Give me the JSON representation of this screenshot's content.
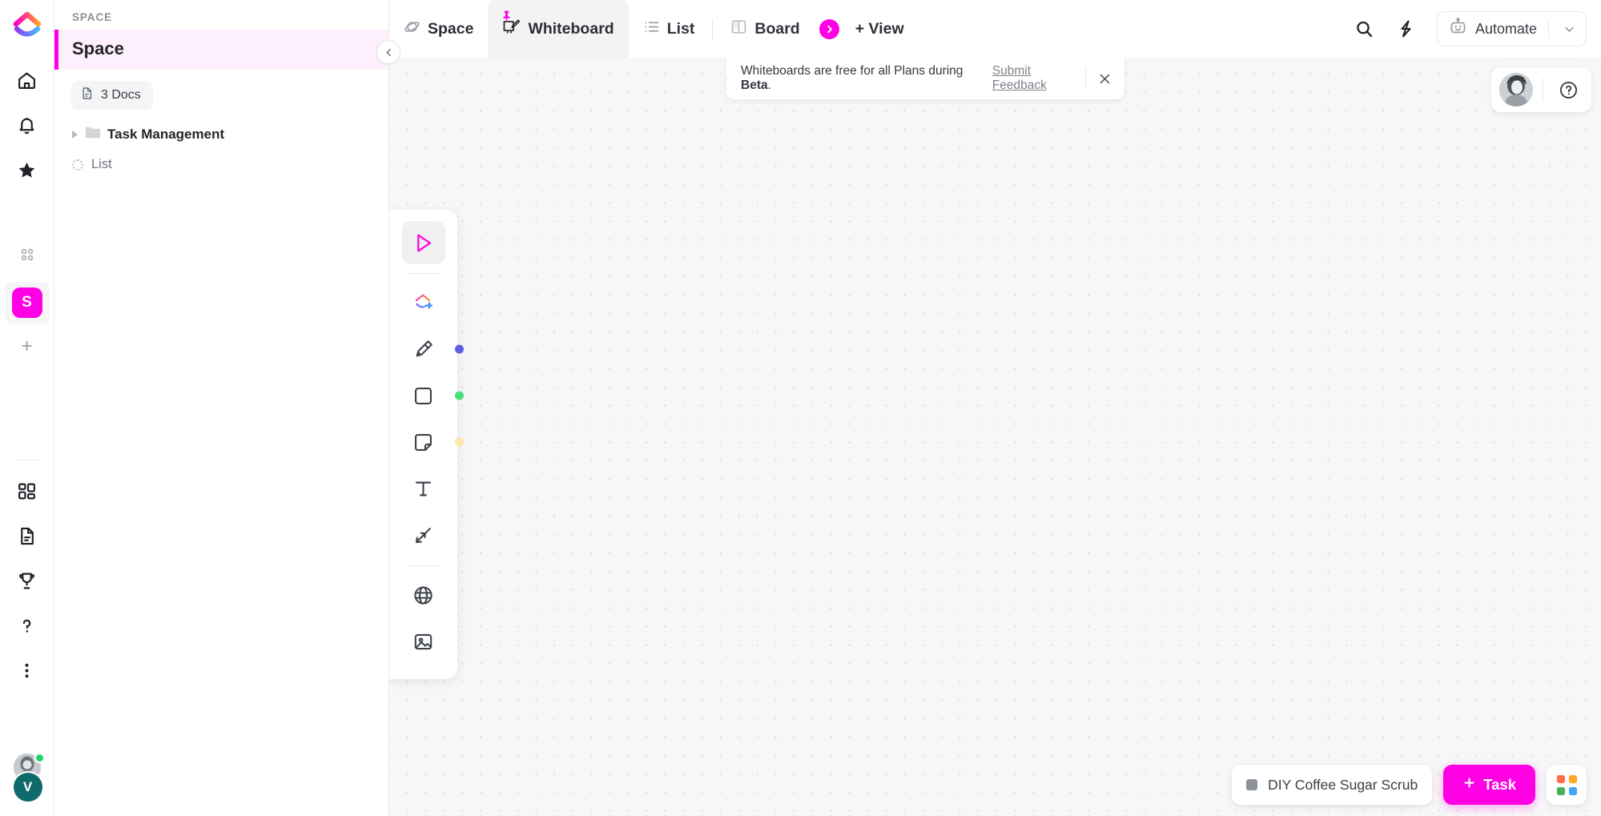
{
  "rail": {
    "logo_icon": "clickup-logo-icon",
    "items": [
      {
        "name": "home",
        "icon": "home-icon"
      },
      {
        "name": "notifications",
        "icon": "bell-icon"
      },
      {
        "name": "favorites",
        "icon": "star-icon"
      },
      {
        "name": "apps",
        "icon": "four-dot-grid-icon"
      }
    ],
    "space_badge": "S",
    "add_label": "+",
    "lower_items": [
      {
        "name": "dashboards",
        "icon": "dashboard-grid-icon"
      },
      {
        "name": "docs",
        "icon": "document-icon"
      },
      {
        "name": "goals",
        "icon": "trophy-icon"
      },
      {
        "name": "help",
        "icon": "question-mark-icon"
      },
      {
        "name": "more",
        "icon": "three-dots-vertical-icon"
      }
    ],
    "avatar_initial": "V"
  },
  "sidebar": {
    "section_label": "SPACE",
    "space_name": "Space",
    "docs_chip": "3 Docs",
    "folder": "Task Management",
    "list": "List",
    "accent_color": "#ff00e5",
    "active_bg": "#fdeffc"
  },
  "topbar": {
    "tabs": [
      {
        "label": "Space",
        "icon": "space-orbit-icon",
        "active": false,
        "strong": true
      },
      {
        "label": "Whiteboard",
        "icon": "whiteboard-icon",
        "active": true,
        "pinned": true
      },
      {
        "label": "List",
        "icon": "list-icon",
        "active": false
      },
      {
        "label": "Board",
        "icon": "board-columns-icon",
        "active": false
      }
    ],
    "add_view_label": "+ View",
    "search_icon": "search-icon",
    "bolt_icon": "lightning-bolt-icon",
    "automate_label": "Automate",
    "automate_icon": "robot-icon",
    "chevron_icon": "chevron-down-icon"
  },
  "banner": {
    "text_before": "Whiteboards are free for all Plans during ",
    "bold": "Beta",
    "text_after": ".",
    "link": "Submit Feedback",
    "close_icon": "close-icon"
  },
  "help_pill": {
    "avatar": "user-avatar",
    "help_icon": "question-circle-icon"
  },
  "toolbar": {
    "tools": [
      {
        "name": "select-cursor",
        "icon": "cursor-arrow-icon",
        "active": true
      },
      {
        "name": "add-task",
        "icon": "clickup-task-add-icon",
        "active": false
      },
      {
        "name": "pen",
        "icon": "pen-highlighter-icon",
        "active": false,
        "dot": "#5b5fe3"
      },
      {
        "name": "shape",
        "icon": "square-shape-icon",
        "active": false,
        "dot": "#4ade80"
      },
      {
        "name": "sticky-note",
        "icon": "sticky-note-icon",
        "active": false,
        "dot": "#fce6a8"
      },
      {
        "name": "text",
        "icon": "text-t-icon",
        "active": false
      },
      {
        "name": "connector",
        "icon": "connector-arrows-icon",
        "active": false
      },
      {
        "name": "embed",
        "icon": "globe-icon",
        "active": false
      },
      {
        "name": "image",
        "icon": "image-icon",
        "active": false
      }
    ]
  },
  "bottom": {
    "task_chip": "DIY Coffee Sugar Scrub",
    "task_button": "Task",
    "apps_icon": "apps-grid-icon",
    "apps_colors": [
      "#ff6b4a",
      "#ffa726",
      "#4caf50",
      "#42a5f5"
    ]
  }
}
